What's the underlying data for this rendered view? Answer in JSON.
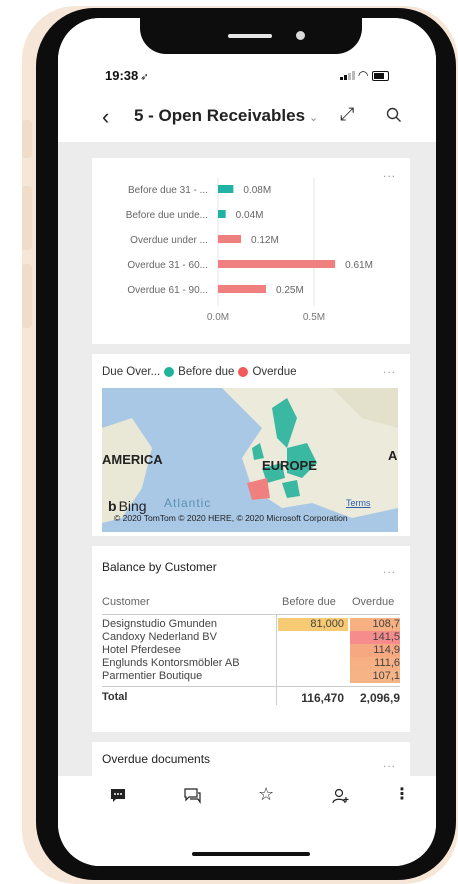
{
  "status": {
    "time": "19:38"
  },
  "header": {
    "title": "5 - Open Receivables",
    "expand_icon": "expand-icon",
    "search_icon": "search-icon"
  },
  "visual_menu_label": "...",
  "chart_data": {
    "type": "bar",
    "orientation": "horizontal",
    "categories": [
      "Before due 31 - ...",
      "Before due unde...",
      "Overdue under ...",
      "Overdue 31 - 60...",
      "Overdue 61 - 90..."
    ],
    "values": [
      0.08,
      0.04,
      0.12,
      0.61,
      0.25
    ],
    "value_labels": [
      "0.08M",
      "0.04M",
      "0.12M",
      "0.61M",
      "0.25M"
    ],
    "colors": [
      "#20b3a5",
      "#20b3a5",
      "#f07f7f",
      "#f07f7f",
      "#f07f7f"
    ],
    "xticks": [
      "0.0M",
      "0.5M"
    ],
    "xlim": [
      0,
      0.7
    ],
    "grid": true
  },
  "map": {
    "title": "Due Over...",
    "legend": [
      {
        "label": "Before due",
        "color": "#1fb39b"
      },
      {
        "label": "Overdue",
        "color": "#f05a5a"
      }
    ],
    "labels": {
      "america": "AMERICA",
      "europe": "EUROPE",
      "a": "A",
      "atlantic": "Atlantic"
    },
    "bing": "Bing",
    "terms": "Terms",
    "attribution": "© 2020 TomTom © 2020 HERE, © 2020 Microsoft Corporation"
  },
  "balance": {
    "title": "Balance by Customer",
    "columns": [
      "Customer",
      "Before due",
      "Overdue"
    ],
    "rows": [
      {
        "customer": "Designstudio Gmunden",
        "before": "81,000",
        "overdue": "108,7"
      },
      {
        "customer": "Candoxy Nederland BV",
        "before": "",
        "overdue": "141,5"
      },
      {
        "customer": "Hotel Pferdesee",
        "before": "",
        "overdue": "114,9"
      },
      {
        "customer": "Englunds Kontorsmöbler AB",
        "before": "",
        "overdue": "111,6"
      },
      {
        "customer": "Parmentier Boutique",
        "before": "",
        "overdue": "107,1"
      }
    ],
    "total": {
      "label": "Total",
      "before": "116,470",
      "overdue": "2,096,9"
    },
    "heat_colors": {
      "before": "#f7cb73",
      "overdue_high": "#f68c8c",
      "overdue": "#f6b082"
    }
  },
  "overdue_docs": {
    "title": "Overdue documents"
  },
  "bottom_tabs": [
    "comment-icon",
    "conversation-icon",
    "favorite-star-icon",
    "add-person-icon",
    "more-options-icon"
  ]
}
